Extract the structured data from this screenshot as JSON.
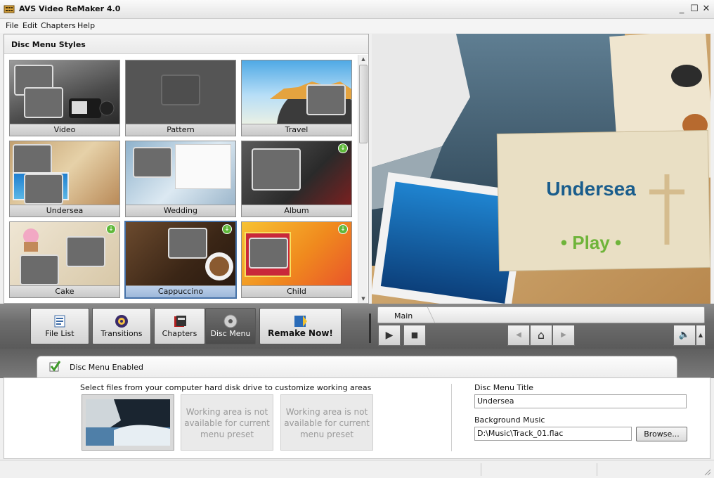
{
  "window": {
    "title": "AVS Video ReMaker 4.0",
    "minimize": "_",
    "maximize": "☐",
    "close": "✕"
  },
  "menu": [
    "File",
    "Edit",
    "Chapters",
    "Help"
  ],
  "styles_panel": {
    "header": "Disc Menu Styles",
    "items": [
      {
        "label": "Video",
        "selected": false,
        "download": false
      },
      {
        "label": "Pattern",
        "selected": false,
        "download": false
      },
      {
        "label": "Travel",
        "selected": false,
        "download": false
      },
      {
        "label": "Undersea",
        "selected": false,
        "download": false
      },
      {
        "label": "Wedding",
        "selected": false,
        "download": false
      },
      {
        "label": "Album",
        "selected": false,
        "download": true
      },
      {
        "label": "Cake",
        "selected": false,
        "download": true
      },
      {
        "label": "Cappuccino",
        "selected": true,
        "download": true
      },
      {
        "label": "Child",
        "selected": false,
        "download": true
      }
    ]
  },
  "preview": {
    "title": "Undersea",
    "play": "• Play •"
  },
  "toolbar": {
    "file_list": "File List",
    "transitions": "Transitions",
    "chapters": "Chapters",
    "disc_menu": "Disc Menu",
    "remake_now": "Remake Now!"
  },
  "player": {
    "breadcrumb": "Main",
    "play_icon": "▶",
    "stop_icon": "■",
    "prev_icon": "◀",
    "home_icon": "⌂",
    "next_icon": "▶",
    "volume_icon": "🔈",
    "volume_menu_icon": "▲"
  },
  "bottom": {
    "tab_label": "Disc Menu Enabled",
    "hint": "Select files from your computer hard disk drive to customize working areas",
    "working_area_unavailable": "Working area is not available for current menu preset",
    "disc_menu_title_label": "Disc Menu Title",
    "disc_menu_title_value": "Undersea",
    "background_music_label": "Background Music",
    "background_music_value": "D:\\Music\\Track_01.flac",
    "browse": "Browse..."
  },
  "colors": {
    "accent": "#4672a8",
    "title_text": "#1a5d8c",
    "play_text": "#6fb43a",
    "download_badge": "#5fb83a"
  }
}
